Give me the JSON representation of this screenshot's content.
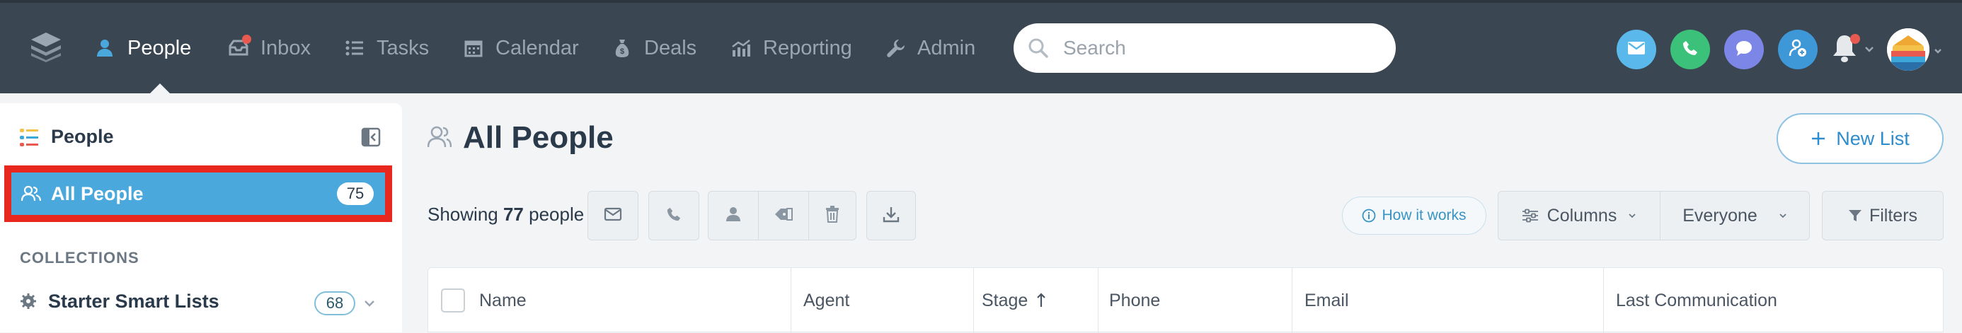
{
  "nav": {
    "items": [
      {
        "label": "People",
        "icon": "person-icon",
        "active": true
      },
      {
        "label": "Inbox",
        "icon": "inbox-icon",
        "active": false
      },
      {
        "label": "Tasks",
        "icon": "list-icon",
        "active": false
      },
      {
        "label": "Calendar",
        "icon": "calendar-icon",
        "active": false
      },
      {
        "label": "Deals",
        "icon": "money-bag-icon",
        "active": false
      },
      {
        "label": "Reporting",
        "icon": "chart-icon",
        "active": false
      },
      {
        "label": "Admin",
        "icon": "wrench-icon",
        "active": false
      }
    ],
    "search_placeholder": "Search",
    "quick_actions": [
      {
        "name": "email",
        "icon": "mail-icon",
        "color": "#5bb8ea"
      },
      {
        "name": "call",
        "icon": "phone-icon",
        "color": "#3cc17a"
      },
      {
        "name": "text",
        "icon": "chat-icon",
        "color": "#7c86e6"
      },
      {
        "name": "add-person",
        "icon": "add-person-icon",
        "color": "#3e97d6"
      }
    ]
  },
  "sidebar": {
    "title": "People",
    "selected": {
      "label": "All People",
      "count": "75"
    },
    "collections_heading": "COLLECTIONS",
    "collections": [
      {
        "label": "Starter Smart Lists",
        "count": "68"
      }
    ]
  },
  "main": {
    "title": "All People",
    "new_list_label": "New List",
    "showing_prefix": "Showing",
    "showing_count": "77",
    "showing_suffix": "people",
    "how_it_works": "How it works",
    "columns_label": "Columns",
    "everyone_label": "Everyone",
    "filters_label": "Filters",
    "table_headers": [
      "Name",
      "Agent",
      "Stage",
      "Phone",
      "Email",
      "Last Communication"
    ]
  },
  "colors": {
    "nav_bg": "#3a4651",
    "accent": "#4aa8dc",
    "highlight_border": "#e8281e"
  }
}
